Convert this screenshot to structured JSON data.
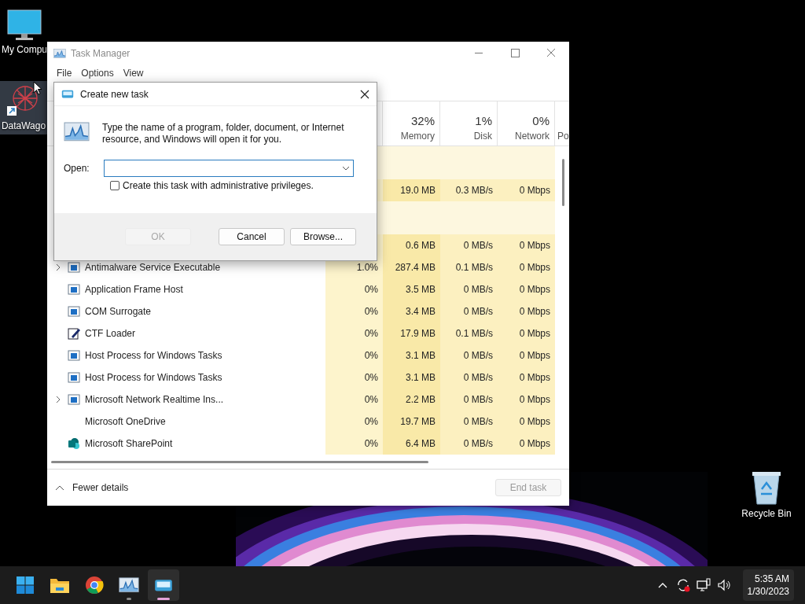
{
  "desktop_icons": [
    {
      "kind": "monitor",
      "label": "My Compu",
      "selected": false
    },
    {
      "kind": "web",
      "label": "DataWago",
      "selected": true
    },
    {
      "kind": "recycle",
      "label": "Recycle Bin",
      "selected": false
    }
  ],
  "task_manager": {
    "title": "Task Manager",
    "menu": [
      "File",
      "Options",
      "View"
    ],
    "columns": [
      {
        "percent": "32%",
        "label": "Memory"
      },
      {
        "percent": "1%",
        "label": "Disk"
      },
      {
        "percent": "0%",
        "label": "Network"
      },
      {
        "label": "Po"
      }
    ],
    "rows": [
      {
        "kind": "group"
      },
      {
        "kind": "plain_process",
        "memory": "19.0 MB",
        "disk": "0.3 MB/s",
        "network": "0 Mbps"
      },
      {
        "kind": "group"
      },
      {
        "kind": "plain_process",
        "memory": "0.6 MB",
        "disk": "0 MB/s",
        "network": "0 Mbps"
      },
      {
        "kind": "window_process",
        "expandable": true,
        "name": "Antimalware Service Executable",
        "cpu": "1.0%",
        "memory": "287.4 MB",
        "disk": "0.1 MB/s",
        "network": "0 Mbps"
      },
      {
        "kind": "window_process",
        "expandable": false,
        "name": "Application Frame Host",
        "cpu": "0%",
        "memory": "3.5 MB",
        "disk": "0 MB/s",
        "network": "0 Mbps"
      },
      {
        "kind": "window_process",
        "expandable": false,
        "name": "COM Surrogate",
        "cpu": "0%",
        "memory": "3.4 MB",
        "disk": "0 MB/s",
        "network": "0 Mbps"
      },
      {
        "kind": "pen_process",
        "expandable": false,
        "name": "CTF Loader",
        "cpu": "0%",
        "memory": "17.9 MB",
        "disk": "0.1 MB/s",
        "network": "0 Mbps"
      },
      {
        "kind": "window_process",
        "expandable": false,
        "name": "Host Process for Windows Tasks",
        "cpu": "0%",
        "memory": "3.1 MB",
        "disk": "0 MB/s",
        "network": "0 Mbps"
      },
      {
        "kind": "window_process",
        "expandable": false,
        "name": "Host Process for Windows Tasks",
        "cpu": "0%",
        "memory": "3.1 MB",
        "disk": "0 MB/s",
        "network": "0 Mbps"
      },
      {
        "kind": "window_process",
        "expandable": true,
        "name": "Microsoft Network Realtime Ins...",
        "cpu": "0%",
        "memory": "2.2 MB",
        "disk": "0 MB/s",
        "network": "0 Mbps"
      },
      {
        "kind": "plain_process",
        "expandable": false,
        "name": "Microsoft OneDrive",
        "cpu": "0%",
        "memory": "19.7 MB",
        "disk": "0 MB/s",
        "network": "0 Mbps"
      },
      {
        "kind": "logo_process",
        "expandable": false,
        "name": "Microsoft SharePoint",
        "cpu": "0%",
        "memory": "6.4 MB",
        "disk": "0 MB/s",
        "network": "0 Mbps"
      }
    ],
    "footer": {
      "toggle": "Fewer details",
      "end_task": {
        "label": "End task",
        "disabled": true
      }
    }
  },
  "dialog": {
    "title": "Create new task",
    "message": "Type the name of a program, folder, document, or Internet resource, and Windows will open it for you.",
    "open_label": "Open:",
    "admin_checkbox": {
      "label": "Create this task with administrative privileges.",
      "checked": false
    },
    "buttons": [
      {
        "label": "OK",
        "disabled": true
      },
      {
        "label": "Cancel",
        "disabled": false
      },
      {
        "label": "Browse...",
        "disabled": false
      }
    ]
  },
  "taskbar": {
    "apps": [
      {
        "kind": "start",
        "selected": false,
        "running": false
      },
      {
        "kind": "folder",
        "selected": false,
        "running": false
      },
      {
        "kind": "browser",
        "selected": false,
        "running": false
      },
      {
        "kind": "taskmgr",
        "selected": false,
        "running": true
      },
      {
        "kind": "run",
        "selected": true,
        "running": true
      }
    ],
    "clock": {
      "time": "5:35 AM",
      "date": "1/30/2023"
    }
  }
}
